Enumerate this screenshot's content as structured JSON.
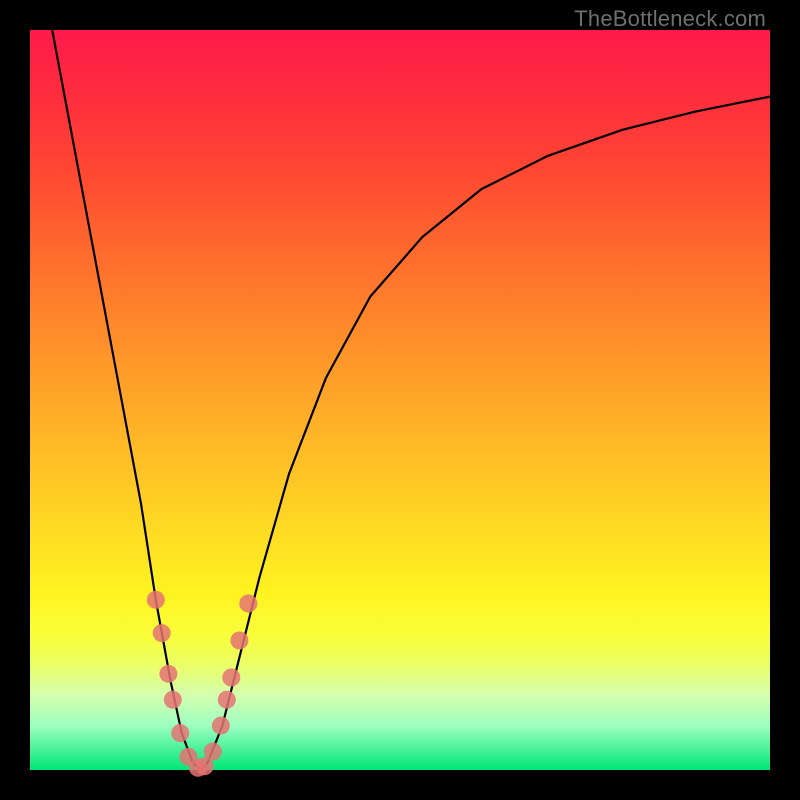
{
  "watermark": "TheBottleneck.com",
  "colors": {
    "frame": "#000000",
    "watermark": "#6f6f6f",
    "curve": "#000000",
    "dot": "#e57373"
  },
  "chart_data": {
    "type": "line",
    "title": "",
    "xlabel": "",
    "ylabel": "",
    "xlim": [
      0,
      100
    ],
    "ylim": [
      0,
      100
    ],
    "grid": false,
    "note": "Numeric values are read off the plot pixel positions; no axis ticks are rendered in the source image, so units are normalized 0–100.",
    "series": [
      {
        "name": "bottleneck-curve",
        "x": [
          3,
          6,
          9,
          12,
          15,
          17,
          19,
          20.5,
          22,
          23,
          24,
          26,
          28,
          31,
          35,
          40,
          46,
          53,
          61,
          70,
          80,
          90,
          100
        ],
        "y": [
          100,
          84,
          68,
          52,
          36,
          23,
          12,
          5,
          1,
          0,
          1,
          6,
          14,
          26,
          40,
          53,
          64,
          72,
          78.5,
          83,
          86.5,
          89,
          91
        ]
      }
    ],
    "markers": {
      "name": "highlighted-points",
      "points": [
        {
          "x": 17.0,
          "y": 23.0
        },
        {
          "x": 17.8,
          "y": 18.5
        },
        {
          "x": 18.7,
          "y": 13.0
        },
        {
          "x": 19.3,
          "y": 9.5
        },
        {
          "x": 20.3,
          "y": 5.0
        },
        {
          "x": 21.4,
          "y": 1.8
        },
        {
          "x": 22.7,
          "y": 0.3
        },
        {
          "x": 23.6,
          "y": 0.5
        },
        {
          "x": 24.7,
          "y": 2.5
        },
        {
          "x": 25.8,
          "y": 6.0
        },
        {
          "x": 26.6,
          "y": 9.5
        },
        {
          "x": 27.2,
          "y": 12.5
        },
        {
          "x": 28.3,
          "y": 17.5
        },
        {
          "x": 29.5,
          "y": 22.5
        }
      ]
    }
  }
}
